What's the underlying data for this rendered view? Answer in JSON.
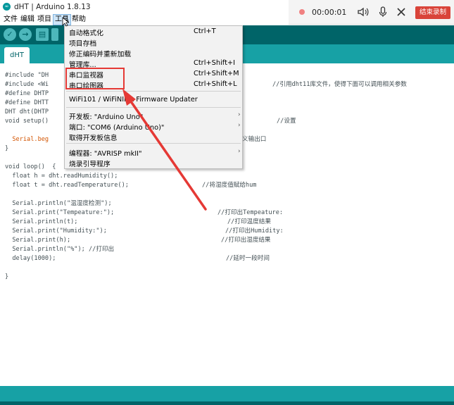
{
  "window": {
    "title": "dHT | Arduino 1.8.13"
  },
  "menubar": {
    "items": [
      "文件",
      "编辑",
      "项目",
      "工具",
      "帮助"
    ]
  },
  "recorder": {
    "time": "00:00:01",
    "stop_label": "结束录制"
  },
  "tab": {
    "label": "dHT"
  },
  "code_lines": [
    "#include \"DH",
    "#include <Wi",
    "#define DHTP",
    "#define DHTT",
    "DHT dht(DHTP",
    "void setup()",
    "",
    "  Serial.beg",
    "}",
    "",
    "void loop()  {",
    "  float h = dht.readHumidity();",
    "  float t = dht.readTemperature();",
    "",
    "  Serial.println(\"温湿度检测\");",
    "  Serial.print(\"Tempeature:\");",
    "  Serial.println(t);",
    "  Serial.print(\"Humidity:\");",
    "  Serial.print(h);",
    "  Serial.println(\"%\"); //打印出",
    "  delay(1000);",
    "",
    "}"
  ],
  "comments": {
    "include": "//引用dht11库文件，使得下面可以调用相关参数",
    "setup": "//设置",
    "serial_begin": "义输出口",
    "read_h": "//将湿度值赋给hum",
    "print_tempeature": "//打印出Tempeature:",
    "print_temp_result": "//打印温度结果",
    "print_humidity": "//打印出Humidity:",
    "print_hum_result": "//打印出湿度结果",
    "delay": "//延时一段时间"
  },
  "tools_menu": {
    "items": [
      {
        "label": "自动格式化",
        "shortcut": "Ctrl+T"
      },
      {
        "label": "项目存档",
        "shortcut": ""
      },
      {
        "label": "修正编码并重新加载",
        "shortcut": ""
      },
      {
        "label": "管理库...",
        "shortcut": "Ctrl+Shift+I"
      },
      {
        "label": "串口监视器",
        "shortcut": "Ctrl+Shift+M"
      },
      {
        "label": "串口绘图器",
        "shortcut": "Ctrl+Shift+L"
      },
      {
        "label": "WiFi101 / WiFiNINA Firmware Updater",
        "shortcut": ""
      },
      {
        "label": "开发板: \"Arduino Uno\"",
        "shortcut": ""
      },
      {
        "label": "端口: \"COM6 (Arduino Uno)\"",
        "shortcut": ""
      },
      {
        "label": "取得开发板信息",
        "shortcut": ""
      },
      {
        "label": "编程器: \"AVRISP mkII\"",
        "shortcut": ""
      },
      {
        "label": "烧录引导程序",
        "shortcut": ""
      }
    ]
  },
  "colors": {
    "toolbar": "#006468",
    "tabbar": "#17a1a5",
    "highlight": "#e53935",
    "recorder_stop": "#d9443a"
  }
}
